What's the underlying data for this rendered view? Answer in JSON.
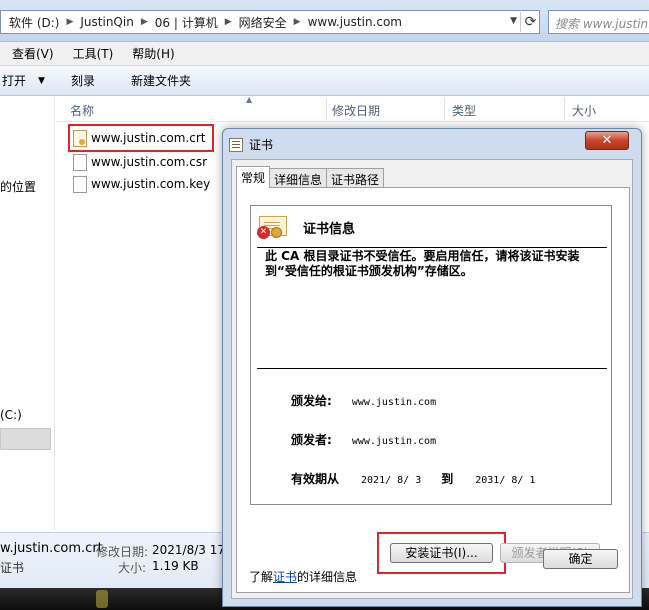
{
  "explorer": {
    "breadcrumb": [
      "软件 (D:)",
      "JustinQin",
      "06 | 计算机",
      "网络安全",
      "www.justin.com"
    ],
    "search_placeholder": "搜索 www.justin.c...",
    "menu": [
      "查看(V)",
      "工具(T)",
      "帮助(H)"
    ],
    "toolbar": {
      "organize": "打开",
      "burn": "刻录",
      "new_folder": "新建文件夹"
    },
    "nav": {
      "location": "的位置",
      "c_drive": "(C:)"
    },
    "columns": [
      "名称",
      "修改日期",
      "类型",
      "大小"
    ],
    "files": [
      {
        "name": "www.justin.com.crt",
        "icon": "certificate-icon",
        "selected": true
      },
      {
        "name": "www.justin.com.csr",
        "icon": "file-icon",
        "selected": false
      },
      {
        "name": "www.justin.com.key",
        "icon": "file-icon",
        "selected": false
      }
    ],
    "status": {
      "name": "w.justin.com.crt",
      "modified_label": "修改日期:",
      "modified_value": "2021/8/3 17",
      "type_label": "证书",
      "size_label": "大小:",
      "size_value": "1.19 KB"
    }
  },
  "dialog": {
    "title": "证书",
    "close": "✕",
    "tabs": [
      "常规",
      "详细信息",
      "证书路径"
    ],
    "heading": "证书信息",
    "warning": "此 CA 根目录证书不受信任。要启用信任，请将该证书安装到“受信任的根证书颁发机构”存储区。",
    "issued_to_label": "颁发给:",
    "issued_to_value": "www.justin.com",
    "issued_by_label": "颁发者:",
    "issued_by_value": "www.justin.com",
    "valid_from_label": "有效期从",
    "valid_from_value": "2021/ 8/ 3",
    "valid_to_word": "到",
    "valid_to_value": "2031/ 8/ 1",
    "install_button": "安装证书(I)...",
    "issuer_statement_button": "颁发者说明(S)",
    "learn_prefix": "了解",
    "learn_link": "证书",
    "learn_suffix": "的详细信息",
    "ok_button": "确定"
  },
  "colors": {
    "highlight_red": "#e0242b",
    "link_blue": "#0645ad",
    "close_red": "#c7442b"
  }
}
